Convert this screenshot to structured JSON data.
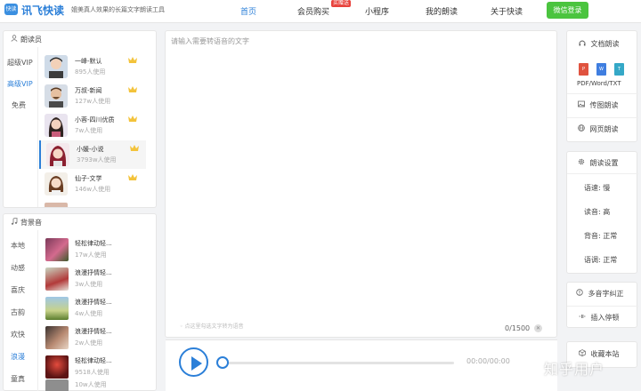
{
  "header": {
    "logo_mark": "快读",
    "logo_text": "讯飞快读",
    "slogan": "媲美真人效果的长篇文字朗读工具",
    "nav": {
      "home": "首页",
      "vip": "会员购买",
      "hot_badge": "买赠送",
      "miniapp": "小程序",
      "my_reading": "我的朗读",
      "about": "关于快读"
    },
    "login_button": "微信登录"
  },
  "voice_panel": {
    "title": "朗读员",
    "tabs": [
      "超级VIP",
      "高级VIP",
      "免费"
    ],
    "active_tab": "高级VIP",
    "items": [
      {
        "name": "一峰-默认",
        "usage": "895人使用"
      },
      {
        "name": "万叔-新闻",
        "usage": "127w人使用"
      },
      {
        "name": "小蓉-四川优质",
        "usage": "7w人使用"
      },
      {
        "name": "小媛-小说",
        "usage": "3793w人使用"
      },
      {
        "name": "仙子-文学",
        "usage": "146w人使用"
      }
    ]
  },
  "bgm_panel": {
    "title": "背景音",
    "tabs": [
      "本地",
      "动感",
      "喜庆",
      "古韵",
      "欢快",
      "浪漫",
      "童真"
    ],
    "active_tab": "浪漫",
    "items": [
      {
        "name": "轻松律动轻...",
        "usage": "17w人使用"
      },
      {
        "name": "浪漫抒情轻...",
        "usage": "3w人使用"
      },
      {
        "name": "浪漫抒情轻...",
        "usage": "4w人使用"
      },
      {
        "name": "浪漫抒情轻...",
        "usage": "2w人使用"
      },
      {
        "name": "轻松律动轻...",
        "usage": "9518人使用"
      },
      {
        "name": "",
        "usage": "10w人使用"
      }
    ]
  },
  "editor": {
    "placeholder": "请输入需要转语音的文字",
    "hint": "点这里勾选文字转为语音",
    "counter": "0/1500",
    "clear_icon": "✕"
  },
  "player": {
    "time": "00:00/00:00"
  },
  "right_panel": {
    "doc_reading": "文档朗读",
    "doc_formats": "PDF/Word/TXT",
    "image_reading": "传图朗读",
    "web_reading": "网页朗读",
    "settings_title": "朗读设置",
    "speed": "语速: 慢",
    "pitch": "读音: 高",
    "bgm_level": "背音: 正常",
    "tone": "语调: 正常",
    "polyphone": "多音字纠正",
    "insert_pause": "插入停顿",
    "bookmark": "收藏本站"
  },
  "watermark": "知乎用户",
  "colors": {
    "accent": "#2b7fd8",
    "wechat_green": "#4bc43f",
    "hot_red": "#e8433d"
  }
}
